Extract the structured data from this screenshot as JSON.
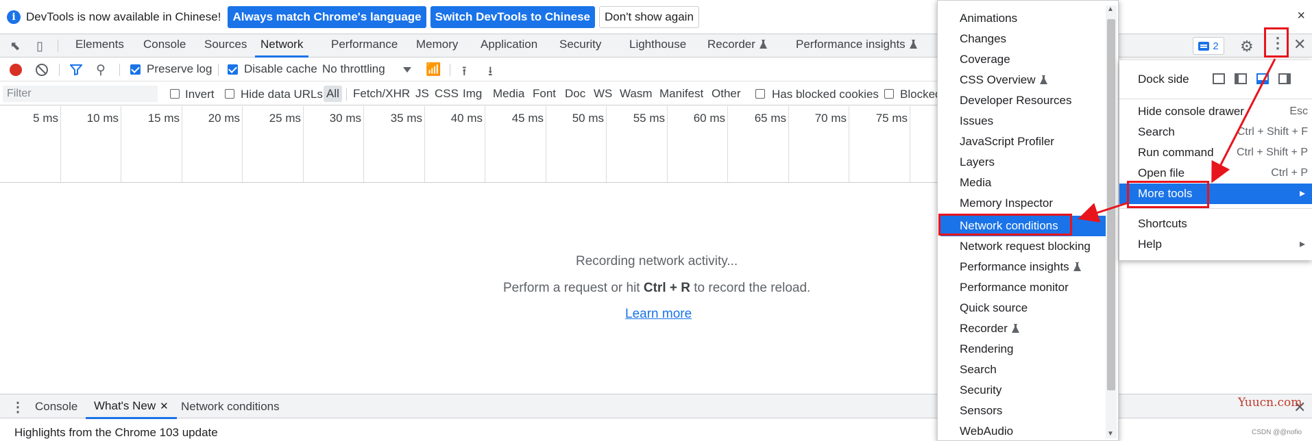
{
  "infobar": {
    "message": "DevTools is now available in Chinese!",
    "btn_match": "Always match Chrome's language",
    "btn_switch": "Switch DevTools to Chinese",
    "btn_dismiss": "Don't show again",
    "close": "×"
  },
  "tabs": {
    "elements": "Elements",
    "console": "Console",
    "sources": "Sources",
    "network": "Network",
    "performance": "Performance",
    "memory": "Memory",
    "application": "Application",
    "security": "Security",
    "lighthouse": "Lighthouse",
    "recorder": "Recorder",
    "perf_insights": "Performance insights",
    "issues_count": "2"
  },
  "network_toolbar": {
    "preserve_log": "Preserve log",
    "disable_cache": "Disable cache",
    "throttling": "No throttling"
  },
  "filterbar": {
    "placeholder": "Filter",
    "invert": "Invert",
    "hide_data_urls": "Hide data URLs",
    "types": [
      "All",
      "Fetch/XHR",
      "JS",
      "CSS",
      "Img",
      "Media",
      "Font",
      "Doc",
      "WS",
      "Wasm",
      "Manifest",
      "Other"
    ],
    "has_blocked_cookies": "Has blocked cookies",
    "blocked": "Blocked"
  },
  "timeline": {
    "ticks": [
      "5 ms",
      "10 ms",
      "15 ms",
      "20 ms",
      "25 ms",
      "30 ms",
      "35 ms",
      "40 ms",
      "45 ms",
      "50 ms",
      "55 ms",
      "60 ms",
      "65 ms",
      "70 ms",
      "75 ms"
    ]
  },
  "empty_state": {
    "line1": "Recording network activity...",
    "line2_pre": "Perform a request or hit ",
    "line2_key": "Ctrl + R",
    "line2_post": " to record the reload.",
    "learn_more": "Learn more"
  },
  "drawer": {
    "tabs": [
      "Console",
      "What's New",
      "Network conditions"
    ],
    "body": "Highlights from the Chrome 103 update"
  },
  "more_tools_menu": {
    "items": [
      "Animations",
      "Changes",
      "Coverage",
      "CSS Overview",
      "Developer Resources",
      "Issues",
      "JavaScript Profiler",
      "Layers",
      "Media",
      "Memory Inspector",
      "Network conditions",
      "Network request blocking",
      "Performance insights",
      "Performance monitor",
      "Quick source",
      "Recorder",
      "Rendering",
      "Search",
      "Security",
      "Sensors",
      "WebAudio"
    ],
    "highlighted": "Network conditions"
  },
  "main_menu": {
    "dock_side": "Dock side",
    "hide_console": "Hide console drawer",
    "hide_console_sc": "Esc",
    "search": "Search",
    "search_sc": "Ctrl + Shift + F",
    "run_command": "Run command",
    "run_command_sc": "Ctrl + Shift + P",
    "open_file": "Open file",
    "open_file_sc": "Ctrl + P",
    "more_tools": "More tools",
    "shortcuts": "Shortcuts",
    "help": "Help"
  },
  "watermark": "Yuucn.com",
  "watermark_small": "CSDN @@nofio",
  "colors": {
    "accent": "#1a73e8",
    "annotation": "#e8141c"
  }
}
